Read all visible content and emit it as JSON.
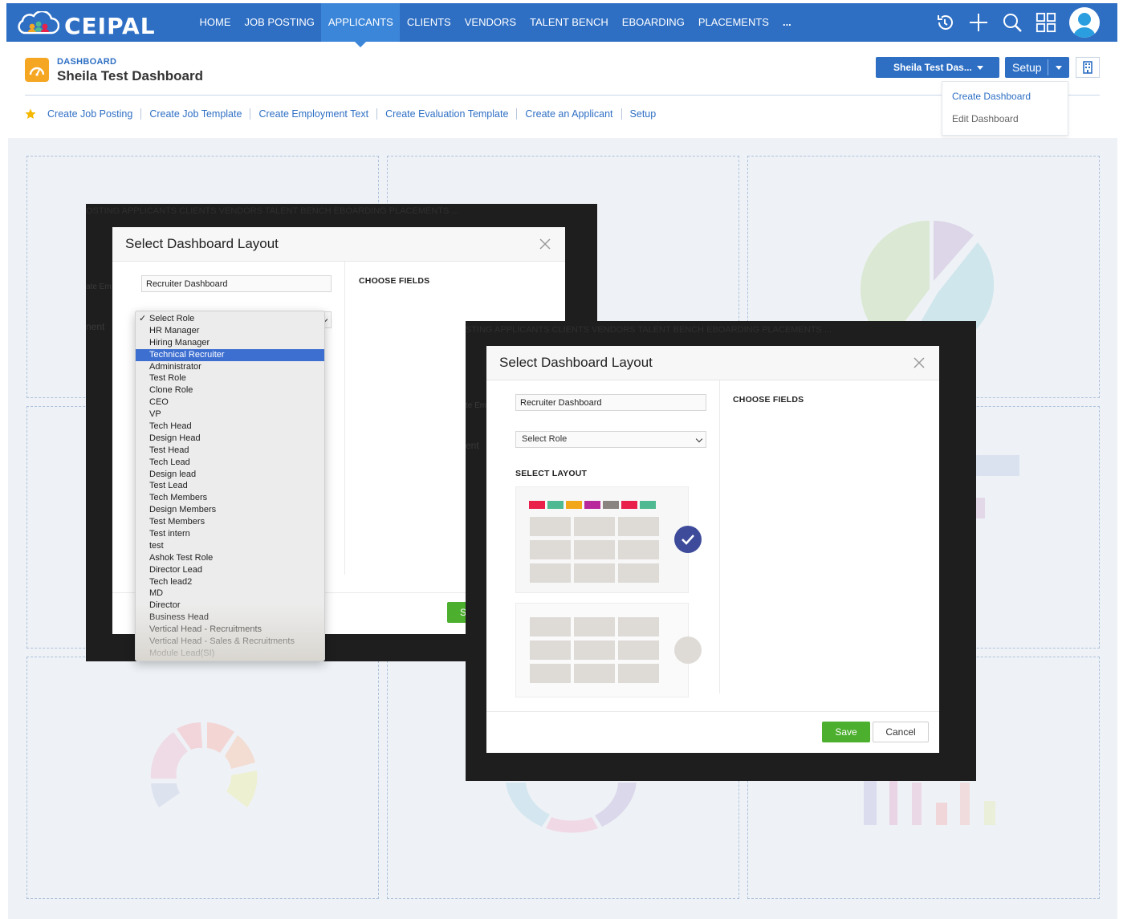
{
  "app": {
    "logo_text": "CEIPAL"
  },
  "nav": {
    "items": [
      {
        "label": "HOME"
      },
      {
        "label": "JOB POSTING"
      },
      {
        "label": "APPLICANTS",
        "active": true
      },
      {
        "label": "CLIENTS"
      },
      {
        "label": "VENDORS"
      },
      {
        "label": "TALENT BENCH"
      },
      {
        "label": "EBOARDING"
      },
      {
        "label": "PLACEMENTS"
      },
      {
        "label": "..."
      }
    ],
    "icons": [
      "history-icon",
      "plus-icon",
      "search-icon",
      "apps-grid-icon",
      "user-avatar"
    ]
  },
  "header": {
    "breadcrumb": "DASHBOARD",
    "title": "Sheila Test Dashboard",
    "dashboard_select": "Sheila Test Das...",
    "setup_label": "Setup",
    "setup_menu": [
      "Create Dashboard",
      "Edit Dashboard"
    ]
  },
  "quick_links": [
    "Create Job Posting",
    "Create Job Template",
    "Create Employment Text",
    "Create Evaluation Template",
    "Create an Applicant",
    "Setup"
  ],
  "modal_back": {
    "ghost_nav": "OSTING   APPLICANTS   CLIENTS   VENDORS   TALENT BENCH   EBOARDING   PLACEMENTS   ...",
    "title": "Select Dashboard Layout",
    "name_value": "Recruiter Dashboard",
    "choose_fields": "CHOOSE FIELDS",
    "ghost_left_1": "nent",
    "ghost_left_2": "ate Em",
    "save_partial": "S",
    "roles": [
      "Select Role",
      "HR Manager",
      "Hiring Manager",
      "Technical Recruiter",
      "Administrator",
      "Test Role",
      "Clone Role",
      "CEO",
      "VP",
      "Tech Head",
      "Design Head",
      "Test Head",
      "Tech Lead",
      "Design lead",
      "Test Lead",
      "Tech Members",
      "Design Members",
      "Test Members",
      "Test intern",
      "test",
      "Ashok Test Role",
      "Director Lead",
      "Tech lead2",
      "MD",
      "Director",
      "Business Head",
      "Vertical Head - Recruitments",
      "Vertical Head - Sales & Recruitments",
      "Module Lead(SI)"
    ],
    "checked_role": "Select Role",
    "highlighted_role": "Technical Recruiter"
  },
  "modal_front": {
    "ghost_nav": "STING   APPLICANTS   CLIENTS   VENDORS   TALENT BENCH   EBOARDING   PLACEMENTS   ...",
    "title": "Select Dashboard Layout",
    "name_value": "Recruiter Dashboard",
    "role_value": "Select Role",
    "choose_fields": "CHOOSE FIELDS",
    "select_layout": "SELECT LAYOUT",
    "ghost_left_1": "te Em",
    "ghost_left_2": "ent",
    "save_label": "Save",
    "cancel_label": "Cancel",
    "swatch_colors": [
      "#e8204a",
      "#4fb991",
      "#f2a71b",
      "#b8279c",
      "#8a8480",
      "#e8204a",
      "#4fb991"
    ],
    "selected_layout": 1
  },
  "colors": {
    "nav_bg": "#2e6fc4",
    "nav_active": "#3b86d9",
    "dashboard_icon": "#f5a623",
    "save_green": "#4caf2e",
    "radio_selected": "#3d4b9a"
  }
}
